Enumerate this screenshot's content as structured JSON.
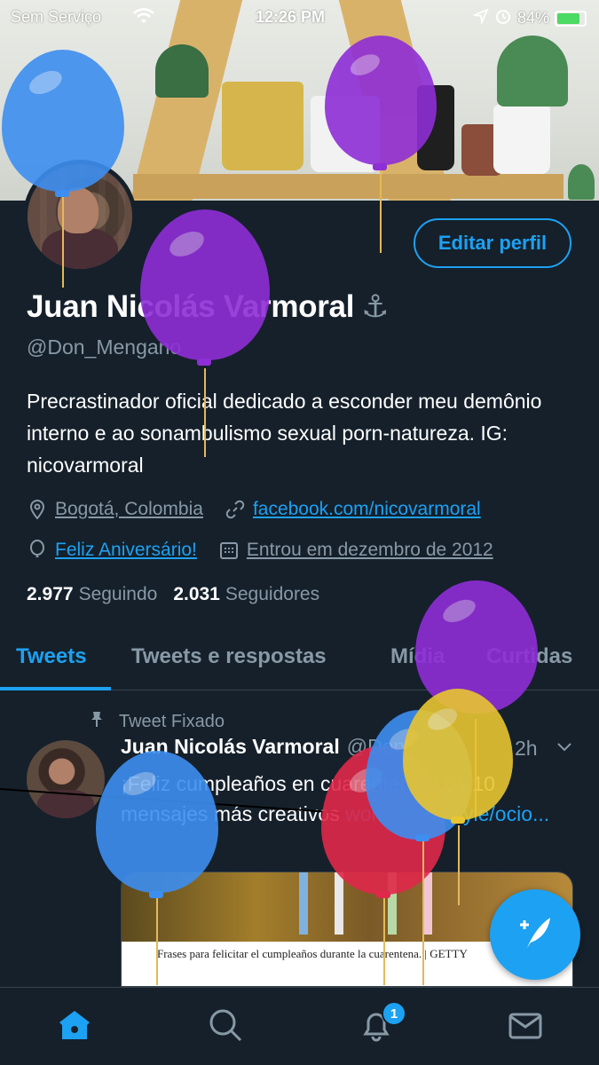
{
  "status_bar": {
    "carrier": "Sem Serviço",
    "time": "12:26 PM",
    "battery": "84%",
    "battery_level": 0.84
  },
  "profile": {
    "edit_button": "Editar perfil",
    "name": "Juan Nicolás Varmoral",
    "name_emoji": "⚓",
    "handle": "@Don_Mengano",
    "bio": "Precrastinador oficial dedicado a esconder meu demônio interno e ao sonambulismo sexual porn-natureza. IG: nicovarmoral",
    "location": "Bogotá, Colombia",
    "website": "facebook.com/nicovarmoral",
    "birthday": "Feliz Aniversário!",
    "joined": "Entrou em dezembro de 2012",
    "following_count": "2.977",
    "following_label": "Seguindo",
    "followers_count": "2.031",
    "followers_label": "Seguidores"
  },
  "tabs": [
    {
      "label": "Tweets",
      "active": true
    },
    {
      "label": "Tweets e respostas",
      "active": false
    },
    {
      "label": "Mídia",
      "active": false
    },
    {
      "label": "Curtidas",
      "active": false
    }
  ],
  "tweet": {
    "pinned_label": "Tweet Fixado",
    "author": "Juan Nicolás Varmoral",
    "handle": "@Don...",
    "time": "2h",
    "text": "¡Feliz cumpleaños en cuarentena! Los 10 mensajes más creativos",
    "url": "wom.es/lifestyle/ocio...",
    "card_caption": "Frases para felicitar el cumpleaños durante la cuarentena. | GETTY"
  },
  "nav": {
    "notification_badge": "1",
    "icons": [
      "home-icon",
      "search-icon",
      "bell-icon",
      "mail-icon"
    ]
  },
  "colors": {
    "background": "#15202b",
    "accent": "#1da1f2",
    "muted": "#8899a6",
    "divider": "#38444d",
    "balloon_purple": "#8e2ed6",
    "balloon_blue": "#3d8ef0",
    "balloon_yellow": "#e8c531",
    "balloon_red": "#e0284a"
  }
}
